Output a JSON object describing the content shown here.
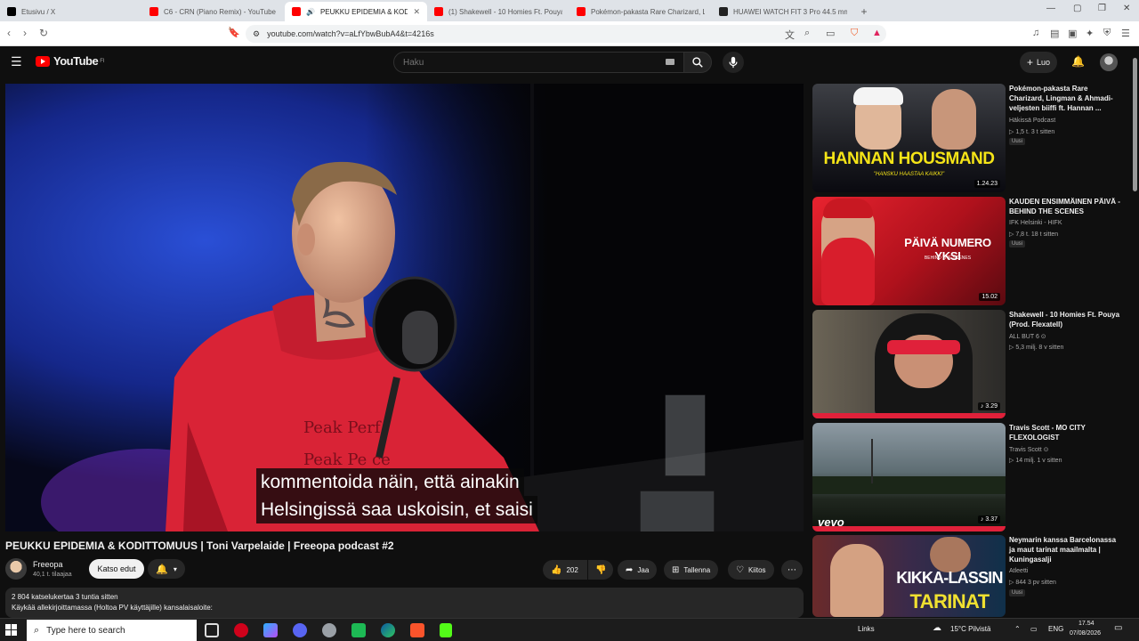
{
  "browser": {
    "tabs": [
      {
        "title": "Etusivu / X",
        "fav": "#000000"
      },
      {
        "title": "C6 - CRN (Piano Remix) - YouTube",
        "fav": "#ff0000"
      },
      {
        "title": "PEUKKU EPIDEMIA & KODIT…",
        "fav": "#ff0000",
        "active": true
      },
      {
        "title": "(1) Shakewell - 10 Homies Ft. Pouya (…",
        "fav": "#ff0000"
      },
      {
        "title": "Pokémon-pakasta Rare Charizard, Lin…",
        "fav": "#ff0000"
      },
      {
        "title": "HUAWEI WATCH FIT 3 Pro 44.5 mm S…",
        "fav": "#222222"
      }
    ],
    "url": "youtube.com/watch?v=aLfYbwBubA4&t=4216s"
  },
  "header": {
    "logo_text": "YouTube",
    "logo_country": "FI",
    "search_placeholder": "Haku",
    "create_label": "Luo"
  },
  "video": {
    "subtitle_line1": "kommentoida näin, että ainakin",
    "subtitle_line2": "Helsingissä saa uskoisin, et saisi",
    "hoodie_text1": "Peak Perf",
    "hoodie_text2": "Peak Pe",
    "hoodie_text3": "ce",
    "title": "PEUKKU EPIDEMIA & KODITTOMUUS | Toni Varpelaide | Freeopa podcast #2"
  },
  "channel": {
    "name": "Freeopa",
    "subscribers": "40,1 t. tilaajaa",
    "join_label": "Katso edut"
  },
  "actions": {
    "likes": "202",
    "share": "Jaa",
    "save": "Tallenna",
    "thanks": "Kiitos"
  },
  "description": {
    "stats": "2 804 katselukertaa  3 tuntia sitten",
    "line2": "Käykää allekirjoittamassa (Holtoa PV käyttäjille) kansalaisaloite:"
  },
  "recommendations": [
    {
      "title": "Pokémon-pakasta Rare Charizard, Lingman & Ahmadi-veljesten biiffi ft. Hannan ...",
      "channel": "Häkissä Podcast",
      "meta": "▷ 1,5 t.   3 t sitten",
      "badge": "Uusi",
      "duration": "1.24.23",
      "overlay": "HANNAN HOUSMAND",
      "overlay_sub": "\"HANSKU HAASTAA KAIKKI\""
    },
    {
      "title": "KAUDEN ENSIMMÄINEN PÄIVÄ - BEHIND THE SCENES",
      "channel": "IFK Helsinki - HIFK",
      "meta": "▷ 7,8 t.   18 t sitten",
      "badge": "Uusi",
      "duration": "15.02",
      "overlay": "PÄIVÄ NUMERO YKSI",
      "overlay_sub": "BEHIND THE SCENES"
    },
    {
      "title": "Shakewell - 10 Homies Ft. Pouya (Prod. Flexatell)",
      "channel": "ALL BUT 6 ⊙",
      "meta": "▷ 5,3 milj.   8 v sitten",
      "duration": "♪ 3.29"
    },
    {
      "title": "Travis Scott - MO CITY FLEXOLOGIST",
      "channel": "Travis Scott ⊙",
      "meta": "▷ 14 milj.   1 v sitten",
      "duration": "♪ 3.37",
      "overlay": "vevo"
    },
    {
      "title": "Neymarin kanssa Barcelonassa ja maut tarinat maailmalta | Kuningasalji",
      "channel": "Atleetti",
      "meta": "▷ 844   3 pv sitten",
      "badge": "Uusi",
      "overlay": "KIKKA-LASSIN",
      "overlay_sub": "TARINAT"
    }
  ],
  "taskbar": {
    "search_placeholder": "Type here to search",
    "links": "Links",
    "weather": "15°C  Pilvistä",
    "lang": "ENG",
    "time": "17.54",
    "date": "07/08/2026"
  }
}
